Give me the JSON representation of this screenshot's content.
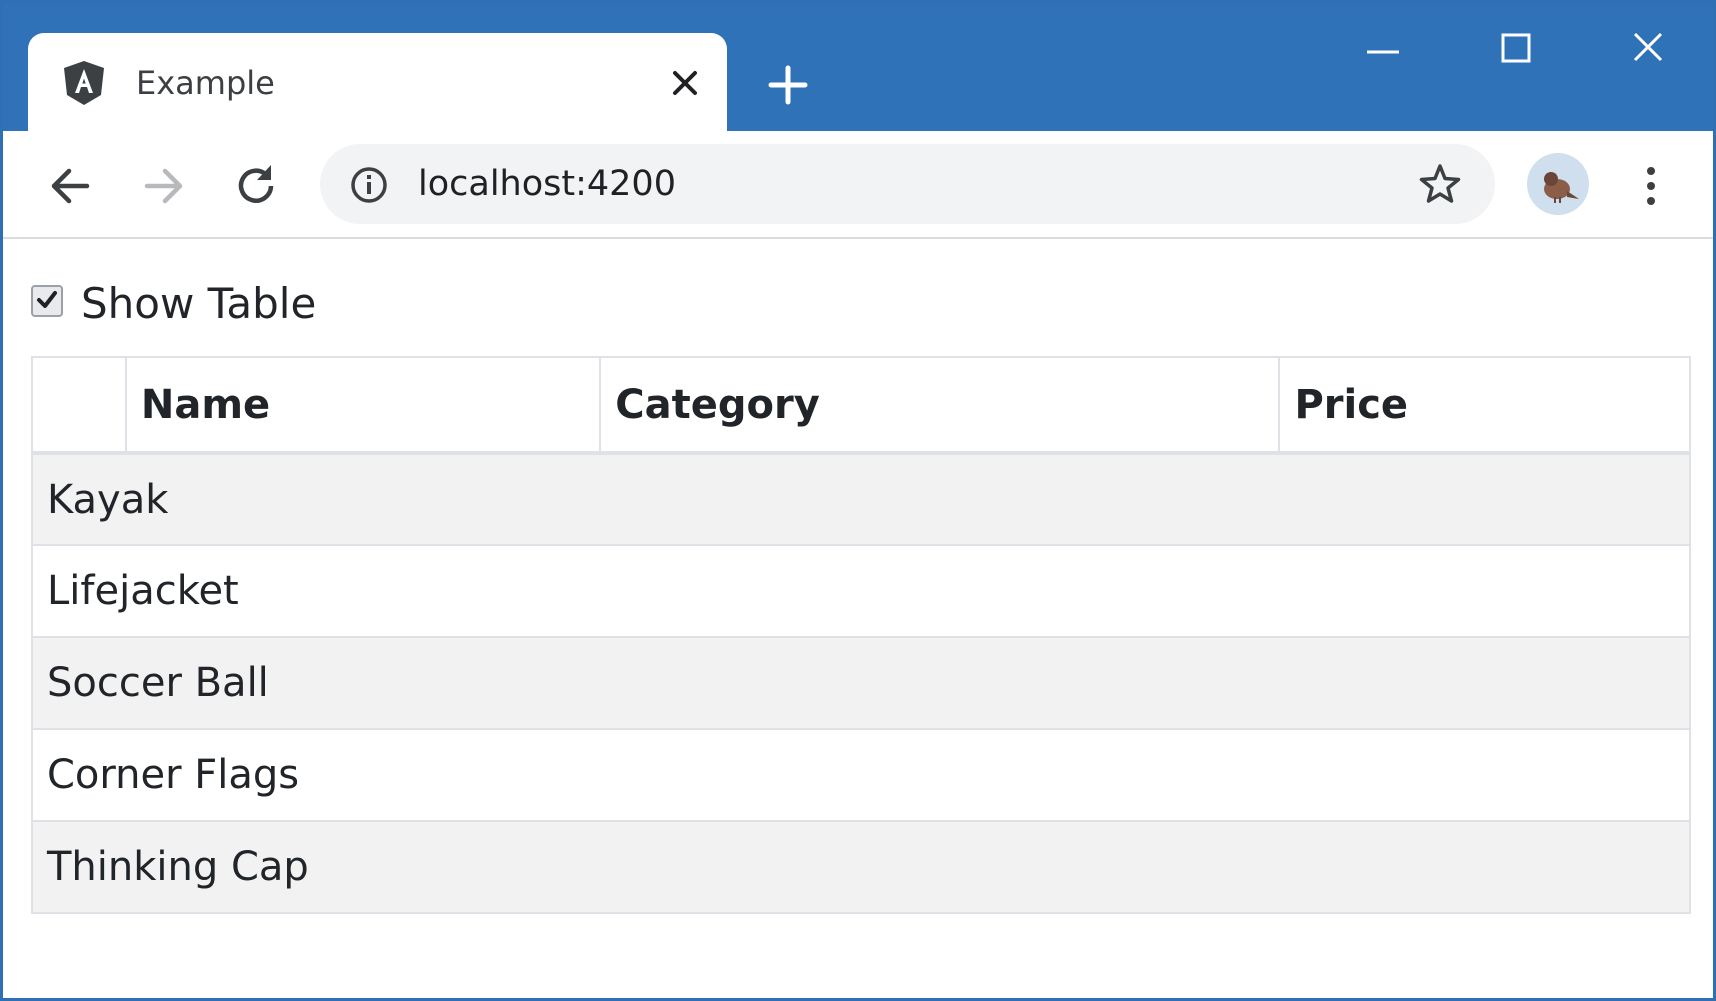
{
  "browser": {
    "tab_title": "Example",
    "url": "localhost:4200"
  },
  "page": {
    "show_table_label": "Show Table",
    "show_table_checked": true,
    "table": {
      "columns": [
        "",
        "Name",
        "Category",
        "Price"
      ],
      "rows": [
        "Kayak",
        "Lifejacket",
        "Soccer Ball",
        "Corner Flags",
        "Thinking Cap"
      ]
    }
  },
  "colors": {
    "titlebar": "#3072b8",
    "row_stripe": "#f2f2f2"
  }
}
